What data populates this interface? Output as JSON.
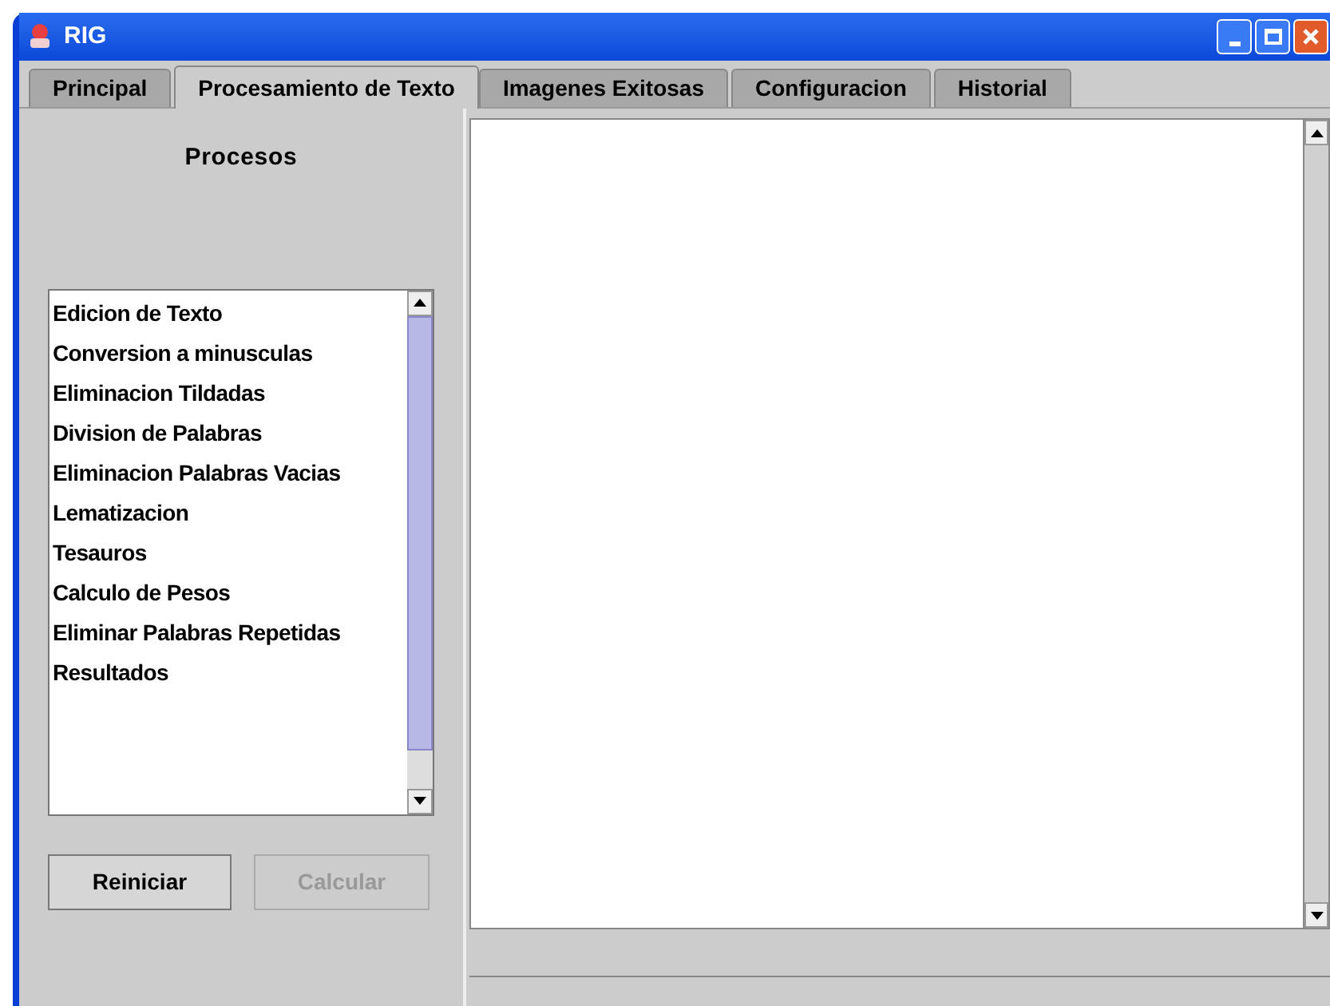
{
  "window": {
    "title": "RIG"
  },
  "tabs": [
    {
      "label": "Principal",
      "selected": false
    },
    {
      "label": "Procesamiento de Texto",
      "selected": true
    },
    {
      "label": "Imagenes Exitosas",
      "selected": false
    },
    {
      "label": "Configuracion",
      "selected": false
    },
    {
      "label": "Historial",
      "selected": false
    }
  ],
  "left_panel": {
    "heading": "Procesos",
    "items": [
      "Edicion de Texto",
      "Conversion a minusculas",
      "Eliminacion Tildadas",
      "Division de Palabras",
      "Eliminacion Palabras Vacias",
      "Lematizacion",
      "Tesauros",
      "Calculo de Pesos",
      "Eliminar Palabras Repetidas",
      "Resultados"
    ],
    "buttons": [
      {
        "label": "Reiniciar",
        "disabled": false
      },
      {
        "label": "Calcular",
        "disabled": true
      }
    ]
  }
}
